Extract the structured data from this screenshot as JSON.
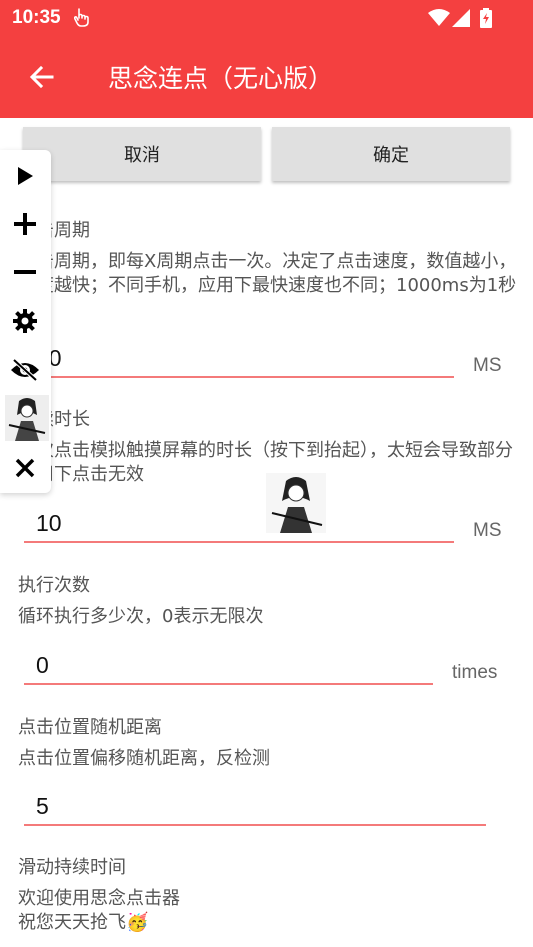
{
  "status": {
    "time": "10:35"
  },
  "appbar": {
    "title": "思念连点（无心版）"
  },
  "buttons": {
    "cancel": "取消",
    "ok": "确定"
  },
  "sections": {
    "period": {
      "label": "点击周期",
      "desc": "点击周期，即每X周期点击一次。决定了点击速度，数值越小，速度越快；不同手机，应用下最快速度也不同；1000ms为1秒",
      "value": "50",
      "unit": "MS"
    },
    "duration": {
      "label": "持续时长",
      "desc": "每次点击模拟触摸屏幕的时长（按下到抬起），太短会导致部分应用下点击无效",
      "value": "10",
      "unit": "MS"
    },
    "count": {
      "label": "执行次数",
      "desc": "循环执行多少次，0表示无限次",
      "value": "0",
      "unit": "times"
    },
    "random": {
      "label": "点击位置随机距离",
      "desc": "点击位置偏移随机距离，反检测",
      "value": "5"
    },
    "swipe": {
      "label": "滑动持续时间",
      "desc_line1": "欢迎使用思念点击器",
      "desc_line2": "祝您天天抢飞🥳"
    }
  },
  "floatbar": {
    "icons": [
      "play-icon",
      "plus-icon",
      "minus-icon",
      "gear-icon",
      "eye-off-icon",
      "close-icon"
    ]
  },
  "colors": {
    "accent": "#f44040",
    "underline": "#f47a7a"
  }
}
